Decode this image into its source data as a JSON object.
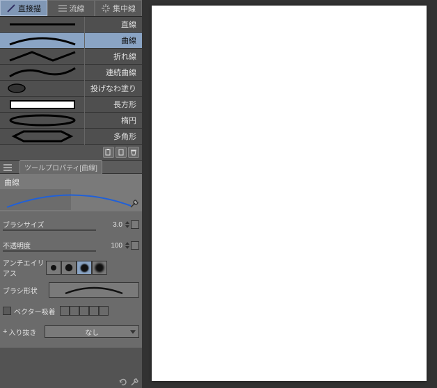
{
  "tabs": {
    "direct": "直接描",
    "flowline": "流線",
    "focusline": "集中線"
  },
  "tools": [
    {
      "id": "line",
      "label": "直線"
    },
    {
      "id": "curve",
      "label": "曲線"
    },
    {
      "id": "polyline",
      "label": "折れ線"
    },
    {
      "id": "continuous_curve",
      "label": "連続曲線"
    },
    {
      "id": "lasso_fill",
      "label": "投げなわ塗り"
    },
    {
      "id": "rectangle",
      "label": "長方形"
    },
    {
      "id": "ellipse",
      "label": "楕円"
    },
    {
      "id": "polygon",
      "label": "多角形"
    }
  ],
  "section_header": "ツールプロパティ[曲線]",
  "preview_label": "曲線",
  "props": {
    "brush_size": {
      "label": "ブラシサイズ",
      "value": "3.0"
    },
    "opacity": {
      "label": "不透明度",
      "value": "100"
    },
    "antialias": {
      "label": "アンチエイリアス"
    },
    "brush_shape": {
      "label": "ブラシ形状"
    },
    "vector_snap": {
      "label": "ベクター吸着"
    },
    "in_out": {
      "label": "入り抜き",
      "value": "なし"
    }
  }
}
